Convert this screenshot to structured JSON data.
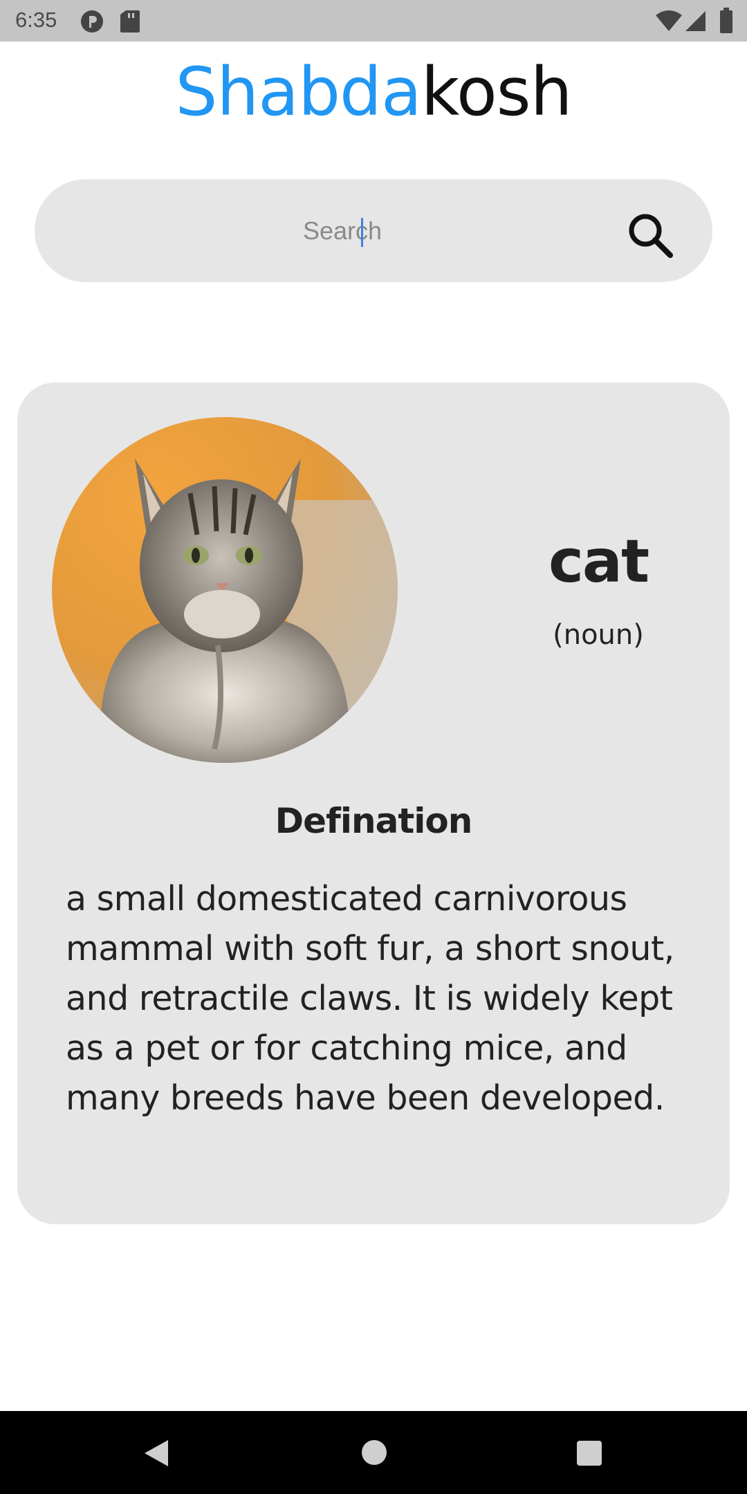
{
  "status_bar": {
    "time": "6:35",
    "icons": [
      "p-badge-icon",
      "sd-card-icon",
      "wifi-icon",
      "signal-icon",
      "battery-icon"
    ]
  },
  "app": {
    "title_part1": "Shabda",
    "title_part2": "kosh",
    "accent_color": "#2196f3"
  },
  "search": {
    "placeholder": "Search",
    "value": ""
  },
  "result": {
    "word": "cat",
    "part_of_speech": "(noun)",
    "image": "cat-photo",
    "definition_heading": "Defination",
    "definition": "a small domesticated carnivorous mammal with soft fur, a short snout, and retractile claws. It is widely kept as a pet or for catching mice, and many breeds have been developed."
  },
  "nav_bar": {
    "buttons": [
      "back-icon",
      "home-icon",
      "recents-icon"
    ]
  }
}
